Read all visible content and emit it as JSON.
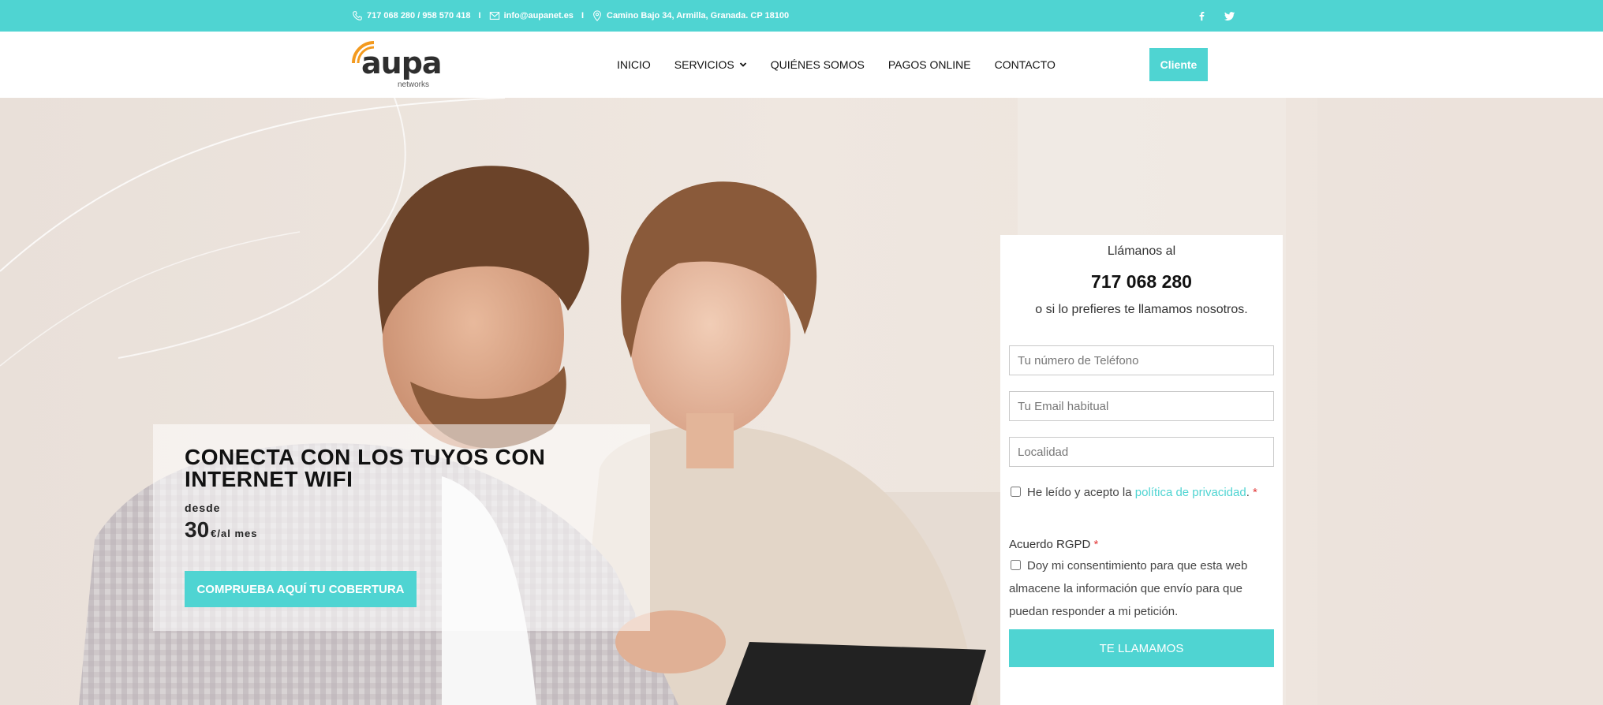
{
  "topbar": {
    "phones": "717 068 280 / 958 570 418",
    "email": "info@aupanet.es",
    "address": "Camino Bajo 34, Armilla, Granada. CP 18100",
    "separator": "I",
    "social_icons": [
      "facebook-icon",
      "twitter-icon"
    ]
  },
  "header": {
    "logo_brand": "aupa",
    "logo_sub": "networks",
    "nav": [
      {
        "label": "INICIO"
      },
      {
        "label": "SERVICIOS",
        "has_dropdown": true
      },
      {
        "label": "QUIÉNES SOMOS"
      },
      {
        "label": "PAGOS ONLINE"
      },
      {
        "label": "CONTACTO"
      }
    ],
    "client_button": "Cliente"
  },
  "hero": {
    "title": "CONECTA CON LOS TUYOS CON INTERNET WIFI",
    "from": "desde",
    "price": "30",
    "price_unit": "€/al mes",
    "cta": "COMPRUEBA AQUÍ TU COBERTURA"
  },
  "form": {
    "call_label": "Llámanos al",
    "phone": "717 068 280",
    "alt_label": "o si lo prefieres te llamamos nosotros.",
    "phone_placeholder": "Tu número de Teléfono",
    "email_placeholder": "Tu Email habitual",
    "city_placeholder": "Localidad",
    "privacy_prefix": "He leído y acepto la",
    "privacy_link": "política de privacidad",
    "privacy_suffix": ".",
    "required_mark": "*",
    "rgpd_label": "Acuerdo RGPD",
    "consent_text": "Doy mi consentimiento para que esta web almacene la información que envío para que puedan responder a mi petición.",
    "submit": "TE LLAMAMOS"
  },
  "colors": {
    "accent": "#4fd4d2",
    "required": "#e23b3b"
  }
}
